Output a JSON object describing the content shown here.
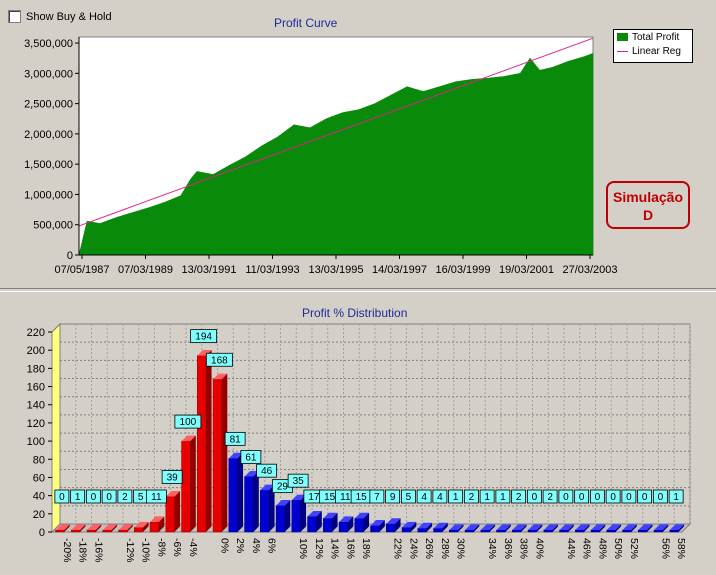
{
  "checkbox": {
    "label": "Show Buy & Hold",
    "checked": false
  },
  "profit_curve": {
    "title": "Profit Curve",
    "legend": {
      "total": "Total Profit",
      "reg": "Linear Reg"
    }
  },
  "stamp": {
    "line1": "Simulação",
    "line2": "D"
  },
  "distribution": {
    "title": "Profit % Distribution"
  },
  "colors": {
    "area": "#0a8a0a",
    "reg": "#e0208a",
    "neg": "#e80000",
    "pos": "#0000d0",
    "label": "#80ffff"
  },
  "chart_data": [
    {
      "type": "area",
      "title": "Profit Curve",
      "x_tick_labels": [
        "07/05/1987",
        "07/03/1989",
        "13/03/1991",
        "11/03/1993",
        "13/03/1995",
        "14/03/1997",
        "16/03/1999",
        "19/03/2001",
        "27/03/2003"
      ],
      "y_tick_labels": [
        "0",
        "500,000",
        "1,000,000",
        "1,500,000",
        "2,000,000",
        "2,500,000",
        "3,000,000",
        "3,500,000"
      ],
      "ylim": [
        0,
        3600000
      ],
      "x": [
        1987.35,
        1987.6,
        1988.0,
        1988.5,
        1989.0,
        1989.5,
        1990.0,
        1990.5,
        1990.8,
        1991.0,
        1991.5,
        1992.0,
        1992.5,
        1993.0,
        1993.5,
        1994.0,
        1994.5,
        1995.0,
        1995.5,
        1996.0,
        1996.5,
        1997.0,
        1997.5,
        1998.0,
        1998.5,
        1999.0,
        1999.5,
        2000.0,
        2000.5,
        2001.0,
        2001.3,
        2001.6,
        2002.0,
        2002.5,
        2003.0,
        2003.25
      ],
      "series": [
        {
          "name": "Total Profit",
          "values": [
            0,
            560000,
            520000,
            620000,
            700000,
            780000,
            870000,
            980000,
            1250000,
            1380000,
            1330000,
            1480000,
            1620000,
            1800000,
            1950000,
            2150000,
            2100000,
            2250000,
            2350000,
            2400000,
            2500000,
            2640000,
            2780000,
            2700000,
            2780000,
            2860000,
            2900000,
            2920000,
            2950000,
            3000000,
            3250000,
            3050000,
            3100000,
            3200000,
            3280000,
            3330000
          ]
        },
        {
          "name": "Linear Reg",
          "values": [
            480000,
            3580000
          ]
        }
      ],
      "legend_position": "top-right"
    },
    {
      "type": "bar",
      "title": "Profit % Distribution",
      "categories": [
        "-20%",
        "-18%",
        "-16%",
        "-14%",
        "-12%",
        "-10%",
        "-8%",
        "-6%",
        "-4%",
        "-2%",
        "0%",
        "2%",
        "4%",
        "6%",
        "8%",
        "10%",
        "12%",
        "14%",
        "16%",
        "18%",
        "20%",
        "22%",
        "24%",
        "26%",
        "28%",
        "30%",
        "32%",
        "34%",
        "36%",
        "38%",
        "40%",
        "42%",
        "44%",
        "46%",
        "48%",
        "50%",
        "52%",
        "54%",
        "56%",
        "58%"
      ],
      "x_tick_labels": [
        "-20%",
        "-18%",
        "-16%",
        "-12%",
        "-10%",
        "-8%",
        "-6%",
        "-4%",
        "0%",
        "2%",
        "4%",
        "6%",
        "10%",
        "12%",
        "14%",
        "16%",
        "18%",
        "22%",
        "24%",
        "26%",
        "28%",
        "30%",
        "34%",
        "36%",
        "38%",
        "40%",
        "44%",
        "46%",
        "48%",
        "50%",
        "52%",
        "56%",
        "58%"
      ],
      "values": [
        0,
        1,
        0,
        0,
        2,
        5,
        11,
        39,
        100,
        194,
        168,
        81,
        61,
        46,
        29,
        35,
        17,
        15,
        11,
        15,
        7,
        9,
        5,
        4,
        4,
        1,
        2,
        1,
        1,
        2,
        0,
        2,
        0,
        0,
        0,
        0,
        0,
        0,
        0,
        1
      ],
      "y_tick_labels": [
        "0",
        "20",
        "40",
        "60",
        "80",
        "100",
        "120",
        "140",
        "160",
        "180",
        "200",
        "220"
      ],
      "ylim": [
        0,
        220
      ],
      "grid": true
    }
  ]
}
